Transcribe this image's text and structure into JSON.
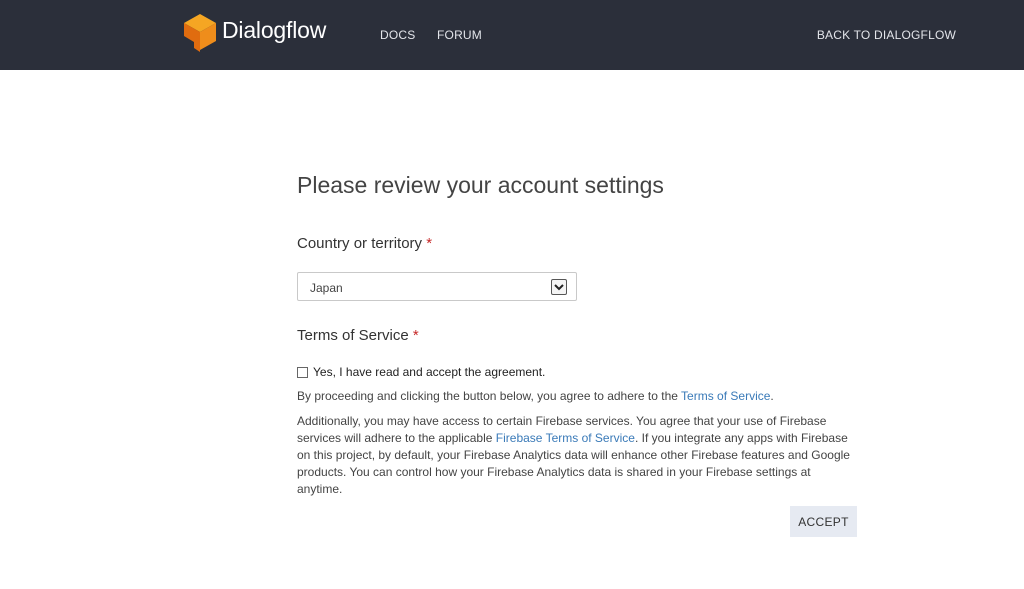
{
  "header": {
    "brand": "Dialogflow",
    "brand_color": "#2b2f3a",
    "logo_icon": "dialogflow-logo-icon",
    "logo_colors": [
      "#f5a623",
      "#ef8d1b",
      "#e06c0f"
    ],
    "nav": [
      {
        "label": "DOCS"
      },
      {
        "label": "FORUM"
      }
    ],
    "back_link": "BACK TO DIALOGFLOW"
  },
  "main": {
    "title": "Please review your account settings",
    "country": {
      "label": "Country or territory",
      "required_mark": "*",
      "selected": "Japan",
      "arrow_icon": "chevron-down-icon"
    },
    "terms": {
      "label": "Terms of Service",
      "required_mark": "*",
      "checkbox_label": "Yes, I have read and accept the agreement.",
      "checked": false,
      "p1_before": "By proceeding and clicking the button below, you agree to adhere to the ",
      "p1_link": "Terms of Service",
      "p1_after": ".",
      "p2_before": "Additionally, you may have access to certain Firebase services. You agree that your use of Firebase services will adhere to the applicable ",
      "p2_link": "Firebase Terms of Service",
      "p2_after": ". If you integrate any apps with Firebase on this project, by default, your Firebase Analytics data will enhance other Firebase features and Google products. You can control how your Firebase Analytics data is shared in your Firebase settings at anytime.",
      "link_color": "#3a7ab8"
    },
    "accept_label": "ACCEPT"
  }
}
